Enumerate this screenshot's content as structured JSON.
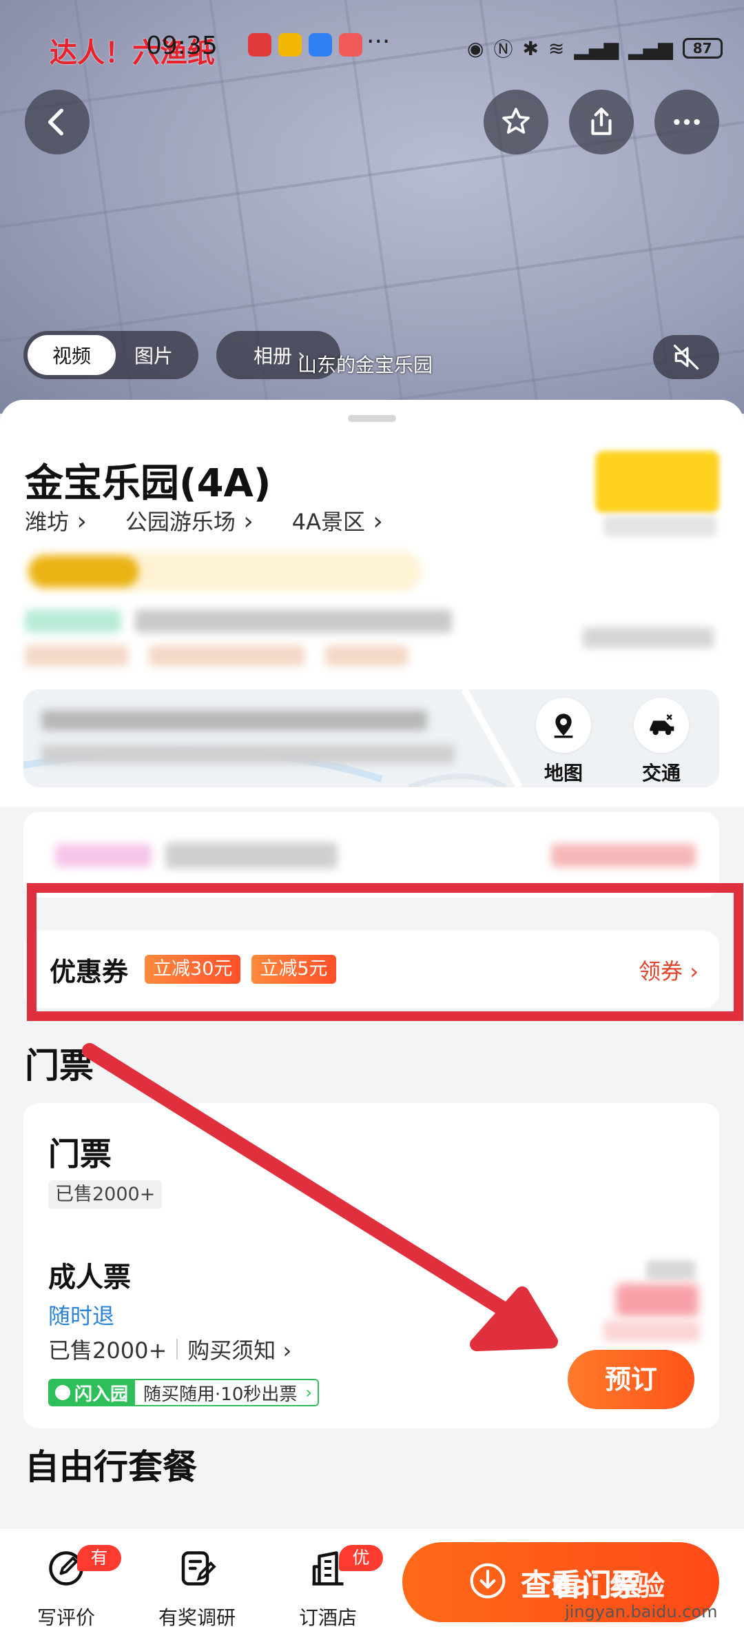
{
  "status_bar": {
    "time": "09:35",
    "overlay_watermark": "达人！六渔纸",
    "more": "···",
    "battery": "87",
    "icons": [
      "eye-icon",
      "nfc-icon",
      "bluetooth-icon",
      "wifi-icon",
      "signal-5g-icon",
      "signal-4g-icon"
    ]
  },
  "hero": {
    "media_tabs": [
      "视频",
      "图片"
    ],
    "album_label": "相册",
    "caption": "山东的金宝乐园",
    "icons": [
      "back-icon",
      "star-icon",
      "share-icon",
      "more-icon",
      "mute-icon"
    ]
  },
  "poi": {
    "title": "金宝乐园(4A)",
    "breadcrumbs": [
      "潍坊",
      "公园游乐场",
      "4A景区"
    ]
  },
  "map": {
    "actions": [
      {
        "label": "地图",
        "icon": "map-pin-icon"
      },
      {
        "label": "交通",
        "icon": "car-icon"
      }
    ]
  },
  "coupon": {
    "title": "优惠券",
    "tags": [
      "立减30元",
      "立减5元"
    ],
    "action": "领券"
  },
  "sections": {
    "tickets": "门票",
    "packages": "自由行套餐"
  },
  "ticket_card": {
    "title": "门票",
    "sold": "已售2000+",
    "product": {
      "name": "成人票",
      "refund": "随时退",
      "sold": "已售2000+",
      "notice": "购买须知",
      "flash_badge": "闪入园",
      "flash_text": "随买随用·10秒出票",
      "book_label": "预订"
    }
  },
  "bottom_bar": {
    "items": [
      {
        "label": "写评价",
        "badge": "有奖",
        "icon": "edit-icon"
      },
      {
        "label": "有奖调研",
        "badge": "",
        "icon": "survey-icon"
      },
      {
        "label": "订酒店",
        "badge": "优惠",
        "icon": "hotel-icon"
      }
    ],
    "cta": "查看门票"
  },
  "watermark": {
    "logo": "Bai 经验",
    "url": "jingyan.baidu.com"
  },
  "colors": {
    "accent_orange": "#ff5418",
    "annotation_red": "#e0303d",
    "refund_blue": "#2a83d9",
    "flash_green": "#2fbf5a"
  }
}
